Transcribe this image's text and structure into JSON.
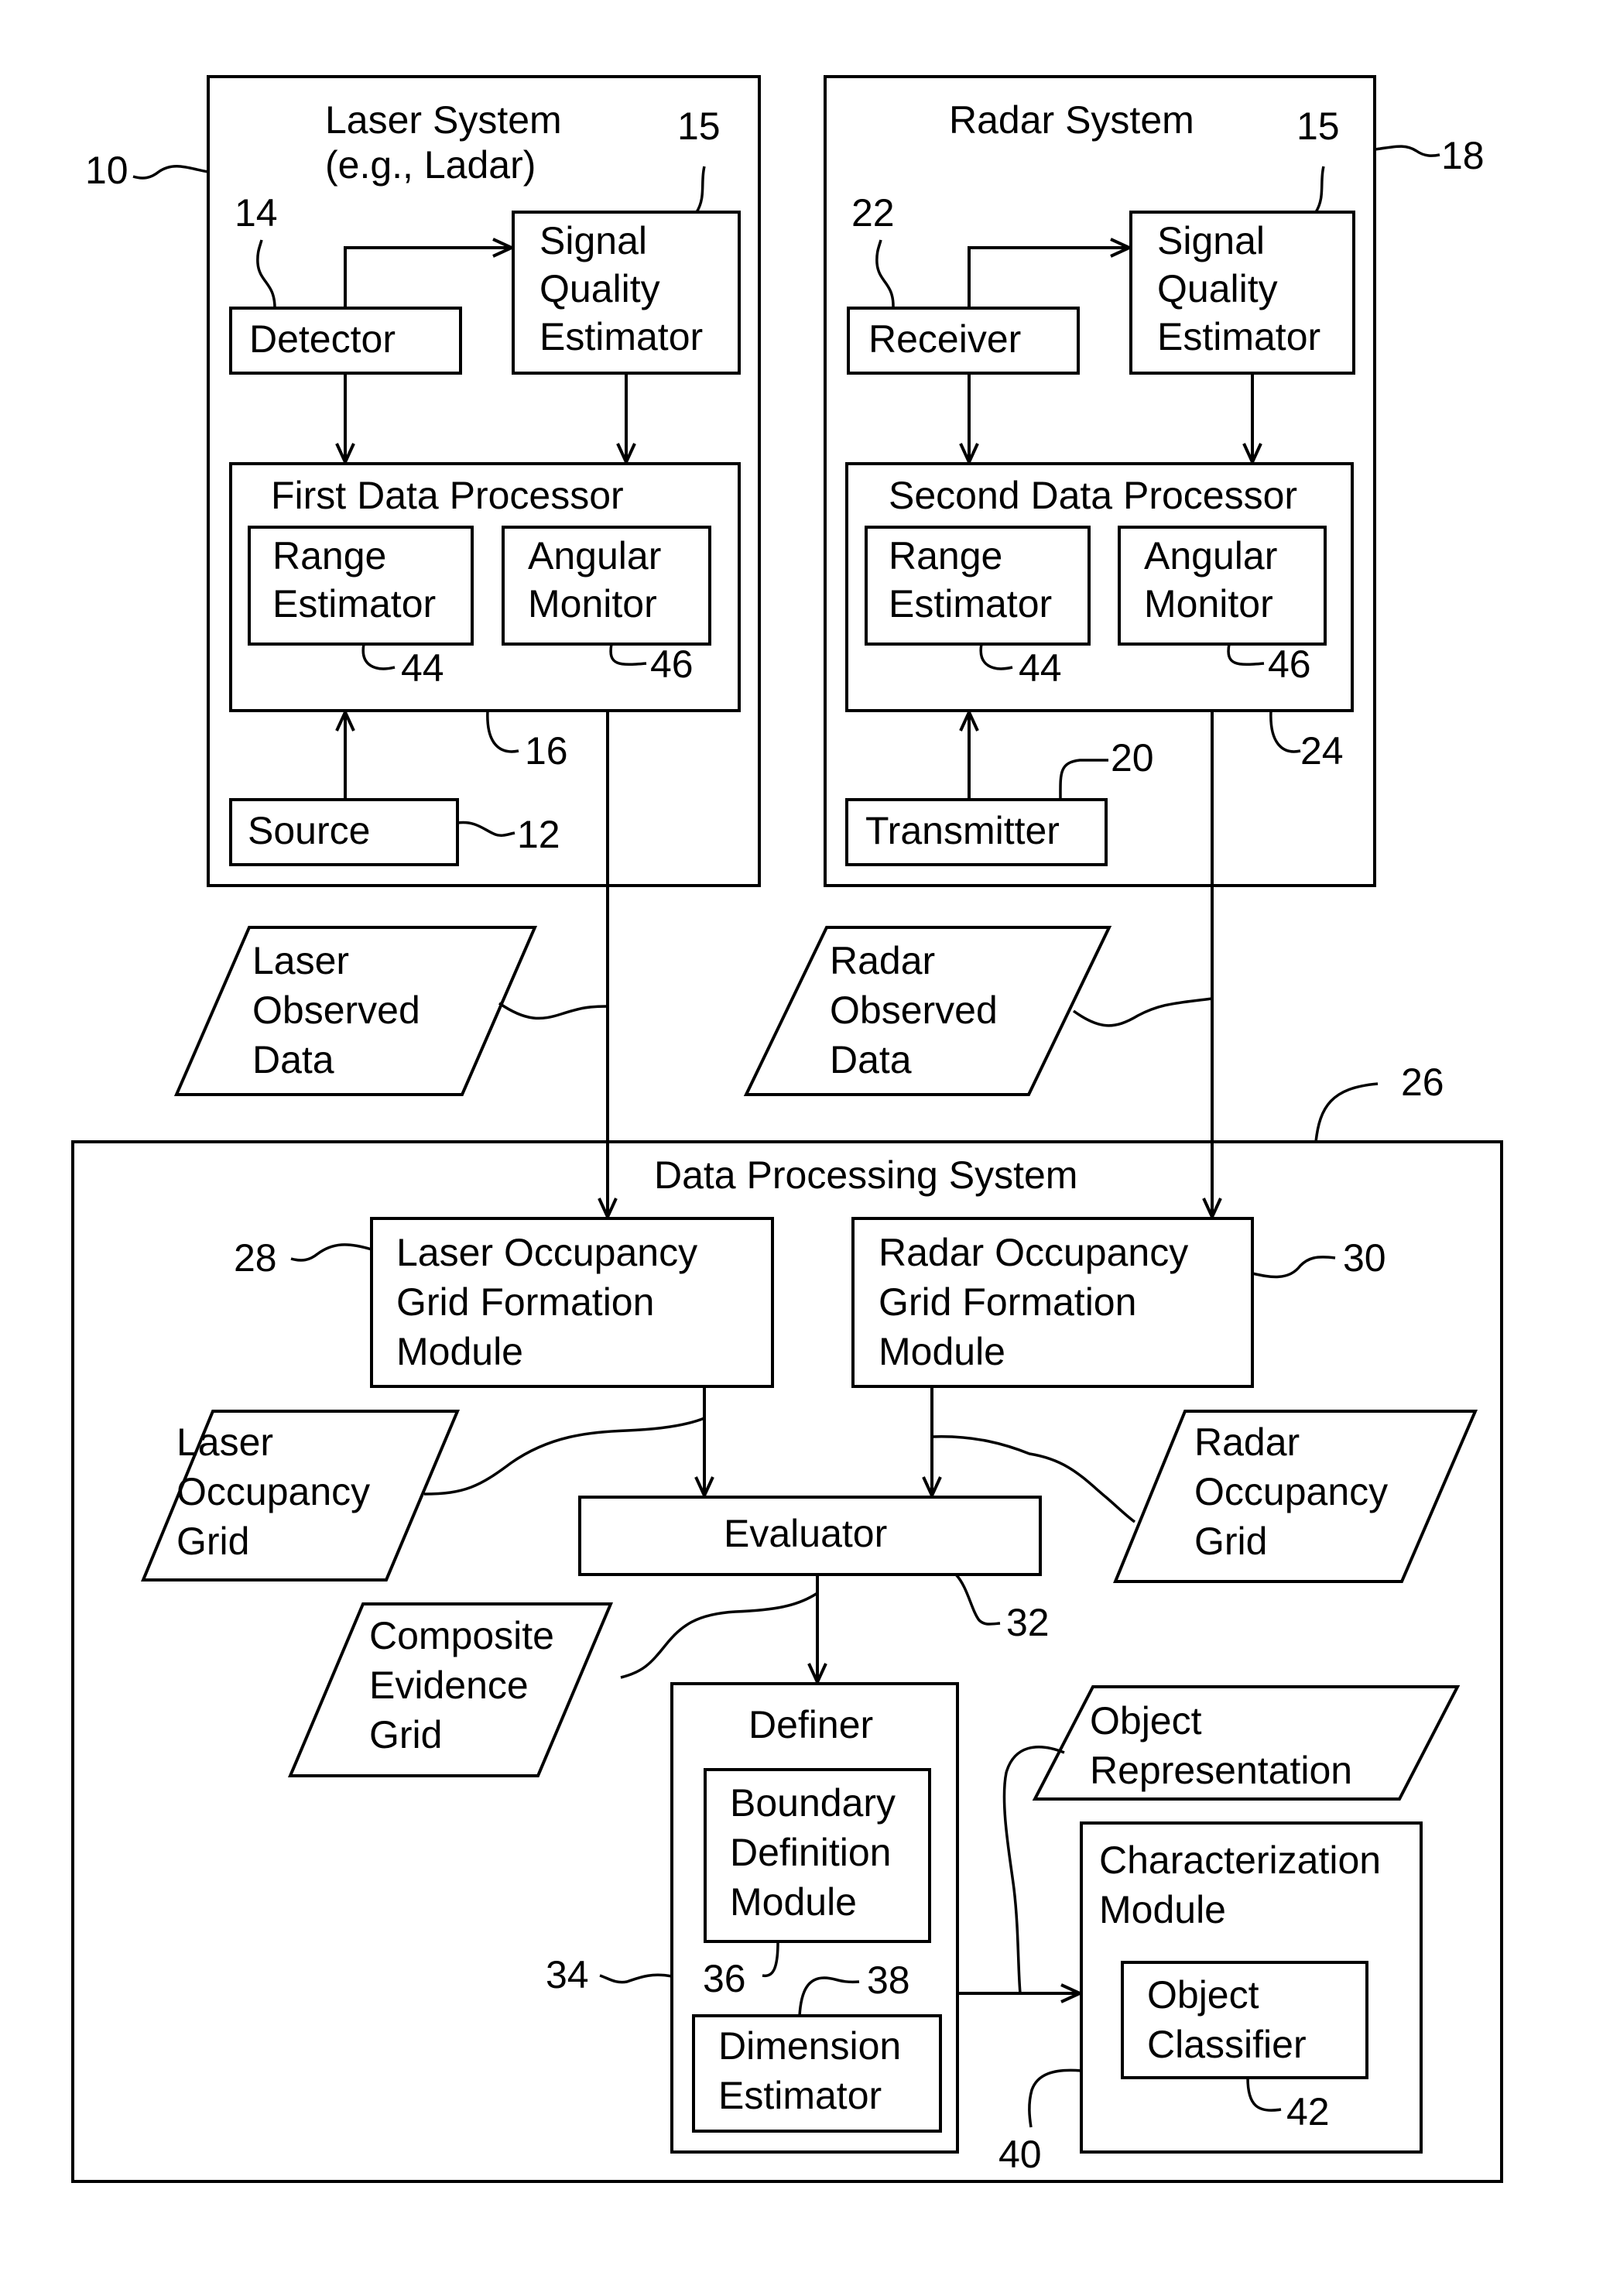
{
  "laser_system": {
    "title_line1": "Laser System",
    "title_line2": "(e.g., Ladar)",
    "ref": "10",
    "detector": {
      "label": "Detector",
      "ref": "14"
    },
    "signal_quality_estimator": {
      "lines": [
        "Signal",
        "Quality",
        "Estimator"
      ],
      "ref": "15"
    },
    "data_processor": {
      "label": "First Data Processor",
      "ref": "16"
    },
    "range_estimator": {
      "lines": [
        "Range",
        "Estimator"
      ],
      "ref": "44"
    },
    "angular_monitor": {
      "lines": [
        "Angular",
        "Monitor"
      ],
      "ref": "46"
    },
    "source": {
      "label": "Source",
      "ref": "12"
    }
  },
  "radar_system": {
    "title": "Radar System",
    "ref": "18",
    "receiver": {
      "label": "Receiver",
      "ref": "22"
    },
    "signal_quality_estimator": {
      "lines": [
        "Signal",
        "Quality",
        "Estimator"
      ],
      "ref": "15"
    },
    "data_processor": {
      "label": "Second Data Processor",
      "ref": "24"
    },
    "range_estimator": {
      "lines": [
        "Range",
        "Estimator"
      ],
      "ref": "44"
    },
    "angular_monitor": {
      "lines": [
        "Angular",
        "Monitor"
      ],
      "ref": "46"
    },
    "transmitter": {
      "label": "Transmitter",
      "ref": "20"
    }
  },
  "laser_observed_data": {
    "lines": [
      "Laser",
      "Observed",
      "Data"
    ]
  },
  "radar_observed_data": {
    "lines": [
      "Radar",
      "Observed",
      "Data"
    ]
  },
  "data_processing_system": {
    "title": "Data Processing System",
    "ref": "26",
    "laser_grid_module": {
      "lines": [
        "Laser Occupancy",
        "Grid Formation",
        "Module"
      ],
      "ref": "28"
    },
    "radar_grid_module": {
      "lines": [
        "Radar Occupancy",
        "Grid Formation",
        "Module"
      ],
      "ref": "30"
    },
    "laser_occupancy_grid": {
      "lines": [
        "Laser",
        "Occupancy",
        "Grid"
      ]
    },
    "radar_occupancy_grid": {
      "lines": [
        "Radar",
        "Occupancy",
        "Grid"
      ]
    },
    "evaluator": {
      "label": "Evaluator",
      "ref": "32"
    },
    "composite_evidence_grid": {
      "lines": [
        "Composite",
        "Evidence",
        "Grid"
      ]
    },
    "definer": {
      "label": "Definer",
      "ref": "34"
    },
    "boundary_module": {
      "lines": [
        "Boundary",
        "Definition",
        "Module"
      ],
      "ref": "36"
    },
    "dimension_estimator": {
      "lines": [
        "Dimension",
        "Estimator"
      ],
      "ref": "38"
    },
    "object_representation": {
      "lines": [
        "Object",
        "Representation"
      ]
    },
    "characterization_module": {
      "lines": [
        "Characterization",
        "Module"
      ],
      "ref": "40"
    },
    "object_classifier": {
      "lines": [
        "Object",
        "Classifier"
      ],
      "ref": "42"
    }
  }
}
